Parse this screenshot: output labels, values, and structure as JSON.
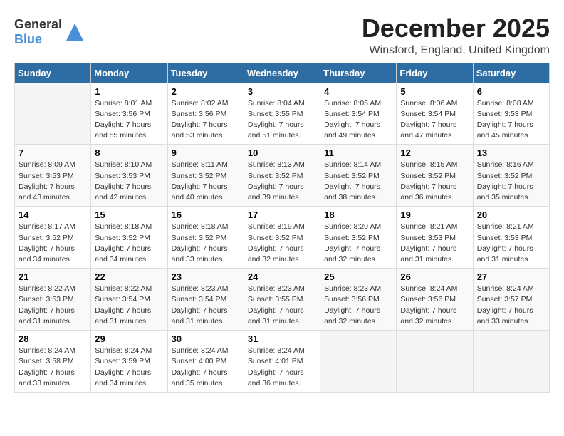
{
  "logo": {
    "general": "General",
    "blue": "Blue"
  },
  "title": "December 2025",
  "subtitle": "Winsford, England, United Kingdom",
  "days_header": [
    "Sunday",
    "Monday",
    "Tuesday",
    "Wednesday",
    "Thursday",
    "Friday",
    "Saturday"
  ],
  "weeks": [
    [
      {
        "day": "",
        "info": ""
      },
      {
        "day": "1",
        "info": "Sunrise: 8:01 AM\nSunset: 3:56 PM\nDaylight: 7 hours\nand 55 minutes."
      },
      {
        "day": "2",
        "info": "Sunrise: 8:02 AM\nSunset: 3:56 PM\nDaylight: 7 hours\nand 53 minutes."
      },
      {
        "day": "3",
        "info": "Sunrise: 8:04 AM\nSunset: 3:55 PM\nDaylight: 7 hours\nand 51 minutes."
      },
      {
        "day": "4",
        "info": "Sunrise: 8:05 AM\nSunset: 3:54 PM\nDaylight: 7 hours\nand 49 minutes."
      },
      {
        "day": "5",
        "info": "Sunrise: 8:06 AM\nSunset: 3:54 PM\nDaylight: 7 hours\nand 47 minutes."
      },
      {
        "day": "6",
        "info": "Sunrise: 8:08 AM\nSunset: 3:53 PM\nDaylight: 7 hours\nand 45 minutes."
      }
    ],
    [
      {
        "day": "7",
        "info": "Sunrise: 8:09 AM\nSunset: 3:53 PM\nDaylight: 7 hours\nand 43 minutes."
      },
      {
        "day": "8",
        "info": "Sunrise: 8:10 AM\nSunset: 3:53 PM\nDaylight: 7 hours\nand 42 minutes."
      },
      {
        "day": "9",
        "info": "Sunrise: 8:11 AM\nSunset: 3:52 PM\nDaylight: 7 hours\nand 40 minutes."
      },
      {
        "day": "10",
        "info": "Sunrise: 8:13 AM\nSunset: 3:52 PM\nDaylight: 7 hours\nand 39 minutes."
      },
      {
        "day": "11",
        "info": "Sunrise: 8:14 AM\nSunset: 3:52 PM\nDaylight: 7 hours\nand 38 minutes."
      },
      {
        "day": "12",
        "info": "Sunrise: 8:15 AM\nSunset: 3:52 PM\nDaylight: 7 hours\nand 36 minutes."
      },
      {
        "day": "13",
        "info": "Sunrise: 8:16 AM\nSunset: 3:52 PM\nDaylight: 7 hours\nand 35 minutes."
      }
    ],
    [
      {
        "day": "14",
        "info": "Sunrise: 8:17 AM\nSunset: 3:52 PM\nDaylight: 7 hours\nand 34 minutes."
      },
      {
        "day": "15",
        "info": "Sunrise: 8:18 AM\nSunset: 3:52 PM\nDaylight: 7 hours\nand 34 minutes."
      },
      {
        "day": "16",
        "info": "Sunrise: 8:18 AM\nSunset: 3:52 PM\nDaylight: 7 hours\nand 33 minutes."
      },
      {
        "day": "17",
        "info": "Sunrise: 8:19 AM\nSunset: 3:52 PM\nDaylight: 7 hours\nand 32 minutes."
      },
      {
        "day": "18",
        "info": "Sunrise: 8:20 AM\nSunset: 3:52 PM\nDaylight: 7 hours\nand 32 minutes."
      },
      {
        "day": "19",
        "info": "Sunrise: 8:21 AM\nSunset: 3:53 PM\nDaylight: 7 hours\nand 31 minutes."
      },
      {
        "day": "20",
        "info": "Sunrise: 8:21 AM\nSunset: 3:53 PM\nDaylight: 7 hours\nand 31 minutes."
      }
    ],
    [
      {
        "day": "21",
        "info": "Sunrise: 8:22 AM\nSunset: 3:53 PM\nDaylight: 7 hours\nand 31 minutes."
      },
      {
        "day": "22",
        "info": "Sunrise: 8:22 AM\nSunset: 3:54 PM\nDaylight: 7 hours\nand 31 minutes."
      },
      {
        "day": "23",
        "info": "Sunrise: 8:23 AM\nSunset: 3:54 PM\nDaylight: 7 hours\nand 31 minutes."
      },
      {
        "day": "24",
        "info": "Sunrise: 8:23 AM\nSunset: 3:55 PM\nDaylight: 7 hours\nand 31 minutes."
      },
      {
        "day": "25",
        "info": "Sunrise: 8:23 AM\nSunset: 3:56 PM\nDaylight: 7 hours\nand 32 minutes."
      },
      {
        "day": "26",
        "info": "Sunrise: 8:24 AM\nSunset: 3:56 PM\nDaylight: 7 hours\nand 32 minutes."
      },
      {
        "day": "27",
        "info": "Sunrise: 8:24 AM\nSunset: 3:57 PM\nDaylight: 7 hours\nand 33 minutes."
      }
    ],
    [
      {
        "day": "28",
        "info": "Sunrise: 8:24 AM\nSunset: 3:58 PM\nDaylight: 7 hours\nand 33 minutes."
      },
      {
        "day": "29",
        "info": "Sunrise: 8:24 AM\nSunset: 3:59 PM\nDaylight: 7 hours\nand 34 minutes."
      },
      {
        "day": "30",
        "info": "Sunrise: 8:24 AM\nSunset: 4:00 PM\nDaylight: 7 hours\nand 35 minutes."
      },
      {
        "day": "31",
        "info": "Sunrise: 8:24 AM\nSunset: 4:01 PM\nDaylight: 7 hours\nand 36 minutes."
      },
      {
        "day": "",
        "info": ""
      },
      {
        "day": "",
        "info": ""
      },
      {
        "day": "",
        "info": ""
      }
    ]
  ]
}
